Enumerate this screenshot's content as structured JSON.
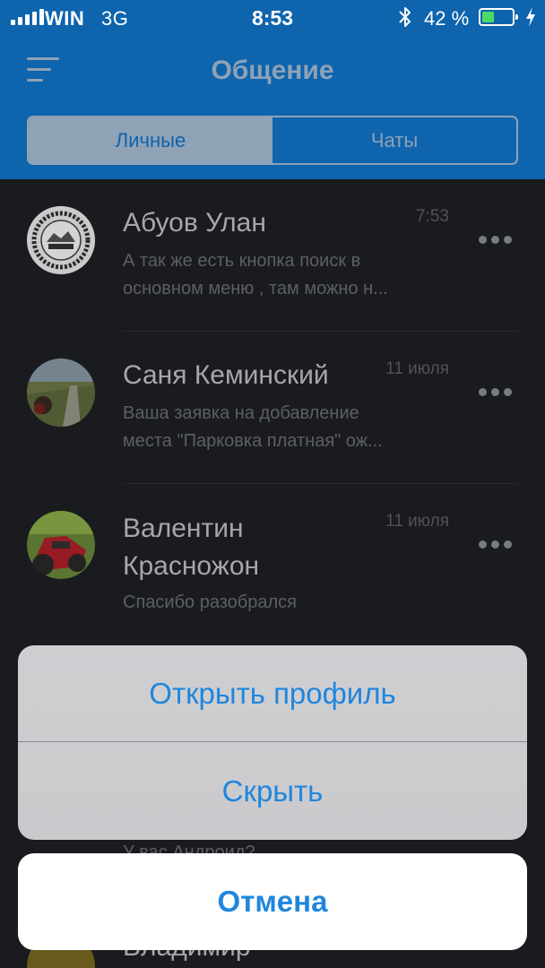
{
  "status_bar": {
    "carrier": "WIN",
    "network": "3G",
    "time": "8:53",
    "battery_percent": "42 %",
    "battery_level": 0.42,
    "icons": [
      "signal-icon",
      "bluetooth-icon",
      "battery-icon",
      "charging-icon"
    ]
  },
  "header": {
    "title": "Общение",
    "tabs": [
      {
        "label": "Личные",
        "active": true
      },
      {
        "label": "Чаты",
        "active": false
      }
    ]
  },
  "chats": [
    {
      "name": "Абуов Улан",
      "time": "7:53",
      "message_line1": "А так же есть кнопка поиск в",
      "message_line2": "основном меню , там можно н..."
    },
    {
      "name": "Саня Кеминский",
      "time": "11 июля",
      "message_line1": "Ваша заявка на добавление",
      "message_line2": "места \"Парковка платная\" ож..."
    },
    {
      "name_line1": "Валентин",
      "name_line2": "Красножон",
      "time": "11 июля",
      "message_line1": "Спасибо разобрался"
    }
  ],
  "partially_visible": {
    "message": "У вас Андроид?",
    "name": "Владимир"
  },
  "action_sheet": {
    "open_profile": "Открыть профиль",
    "hide": "Скрыть",
    "cancel": "Отмена"
  },
  "colors": {
    "header_blue": "#0e64ad",
    "header_text": "#8fa2b6",
    "background": "#1e2024",
    "action_blue": "#1f86dd"
  }
}
